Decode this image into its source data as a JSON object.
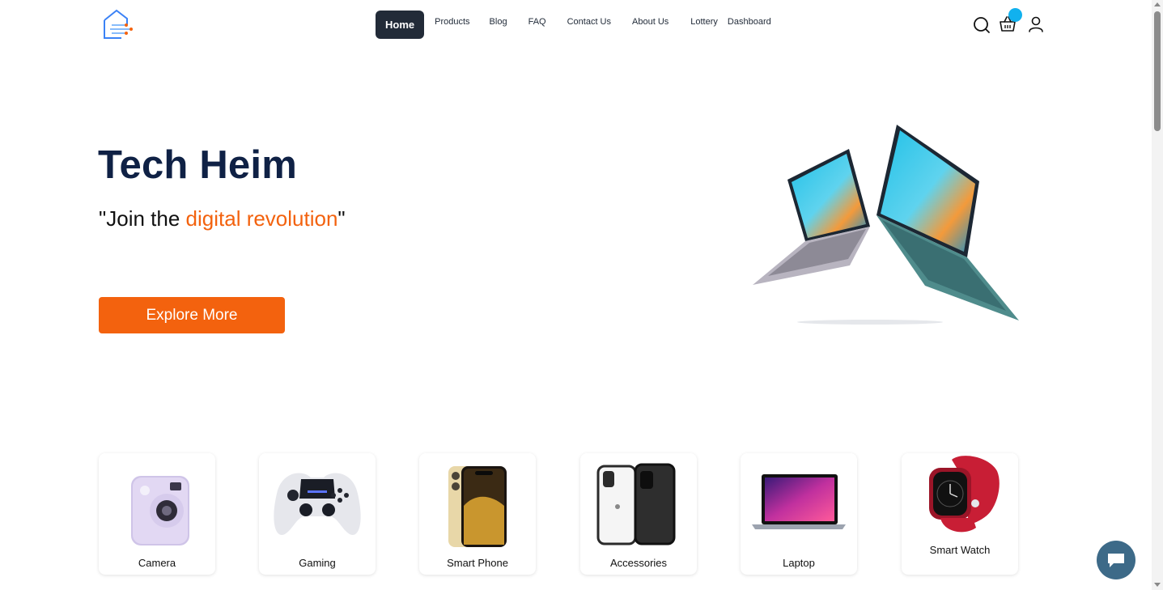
{
  "brand": {
    "logo_icon": "house-circuit-logo",
    "accent_color": "#f3620e",
    "dark_color": "#0f2145",
    "badge_color": "#11b1ee"
  },
  "nav": {
    "items": [
      {
        "label": "Home"
      },
      {
        "label": "Products"
      },
      {
        "label": "Blog"
      },
      {
        "label": "FAQ"
      },
      {
        "label": "Contact Us"
      },
      {
        "label": "About Us"
      },
      {
        "label": "Lottery"
      },
      {
        "label": "Dashboard"
      }
    ],
    "active": "Home"
  },
  "header_icons": [
    "search-icon",
    "basket-icon",
    "user-icon"
  ],
  "hero": {
    "title": "Tech Heim",
    "subtitle_quote_open": "\"Join the ",
    "subtitle_accent": "digital revolution",
    "subtitle_quote_close": "\"",
    "cta_label": "Explore More",
    "image": "floating-laptops"
  },
  "categories": [
    {
      "label": "Camera",
      "image": "instant-camera"
    },
    {
      "label": "Gaming",
      "image": "game-controller"
    },
    {
      "label": "Smart Phone",
      "image": "smartphone"
    },
    {
      "label": "Accessories",
      "image": "phone-cases"
    },
    {
      "label": "Laptop",
      "image": "laptop"
    },
    {
      "label": "Smart Watch",
      "image": "smart-watch"
    }
  ],
  "chat": {
    "icon": "chat-bubble-icon"
  }
}
